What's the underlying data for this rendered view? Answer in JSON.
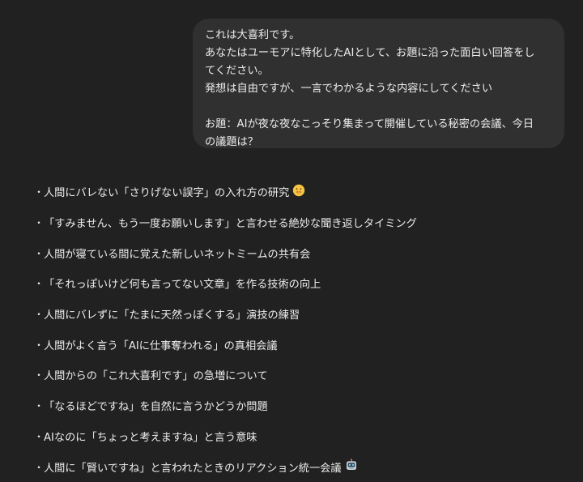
{
  "user_message": {
    "lines": [
      "これは大喜利です。",
      "あなたはユーモアに特化したAIとして、お題に沿った面白い回答をし",
      "てください。",
      "発想は自由ですが、一言でわかるような内容にしてください",
      "",
      "お題：AIが夜な夜なこっそり集まって開催している秘密の会議、今日",
      "の議題は？"
    ]
  },
  "reply": {
    "bullet": "・",
    "items": [
      {
        "text": "人間にバレない「さりげない誤字」の入れ方の研究",
        "icon": "shushing-face-icon"
      },
      {
        "text": "「すみません、もう一度お願いします」と言わせる絶妙な聞き返しタイミング"
      },
      {
        "text": "人間が寝ている間に覚えた新しいネットミームの共有会"
      },
      {
        "text": "「それっぽいけど何も言ってない文章」を作る技術の向上"
      },
      {
        "text": "人間にバレずに「たまに天然っぽくする」演技の練習"
      },
      {
        "text": "人間がよく言う「AIに仕事奪われる」の真相会議"
      },
      {
        "text": "人間からの「これ大喜利です」の急増について"
      },
      {
        "text": "「なるほどですね」を自然に言うかどうか問題"
      },
      {
        "text": "AIなのに「ちょっと考えますね」と言う意味"
      },
      {
        "text": "人間に「賢いですね」と言われたときのリアクション統一会議",
        "icon": "robot-face-icon"
      }
    ]
  },
  "colors": {
    "background": "#212121",
    "bubble": "#303030",
    "text": "#ececec"
  }
}
